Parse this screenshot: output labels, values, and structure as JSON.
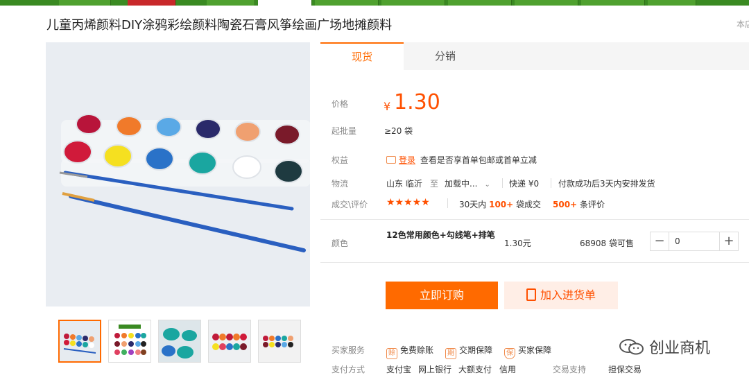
{
  "product": {
    "title": "儿童丙烯颜料DIY涂鸦彩绘颜料陶瓷石膏风筝绘画广场地摊颜料",
    "title_right": "本店"
  },
  "tabs": [
    "现货",
    "分销"
  ],
  "price": {
    "label": "价格",
    "currency": "¥",
    "value": "1.30"
  },
  "moq": {
    "label": "起批量",
    "value": "≥20 袋"
  },
  "benefit": {
    "label": "权益",
    "login": "登录",
    "text": "查看是否享首单包邮或首单立减"
  },
  "logistics": {
    "label": "物流",
    "from": "山东 临沂",
    "to_label": "至",
    "to": "加载中...",
    "express": "快递 ¥0",
    "ship_note": "付款成功后3天内安排发货"
  },
  "trade": {
    "label": "成交\\评价",
    "stars": "★★★★★",
    "period": "30天内",
    "deals": "100+",
    "deals_suffix": "袋成交",
    "reviews": "500+",
    "reviews_suffix": "条评价"
  },
  "sku": {
    "label": "颜色",
    "name": "12色常用颜色+勾线笔+排笔",
    "price": "1.30元",
    "stock": "68908 袋可售",
    "qty": "0",
    "minus": "−",
    "plus": "+"
  },
  "actions": {
    "buy": "立即订购",
    "cart": "加入进货单"
  },
  "services": {
    "label": "买家服务",
    "items": [
      "免费赊账",
      "交期保障",
      "买家保障"
    ]
  },
  "payment": {
    "label": "支付方式",
    "methods": [
      "支付宝",
      "网上银行",
      "大额支付",
      "信用"
    ],
    "support_label": "交易支持",
    "support": "担保交易"
  },
  "watermark": "创业商机",
  "colors": {
    "accent": "#ff6a00",
    "price": "#ff5000",
    "nav_green": "#3a8a22"
  }
}
